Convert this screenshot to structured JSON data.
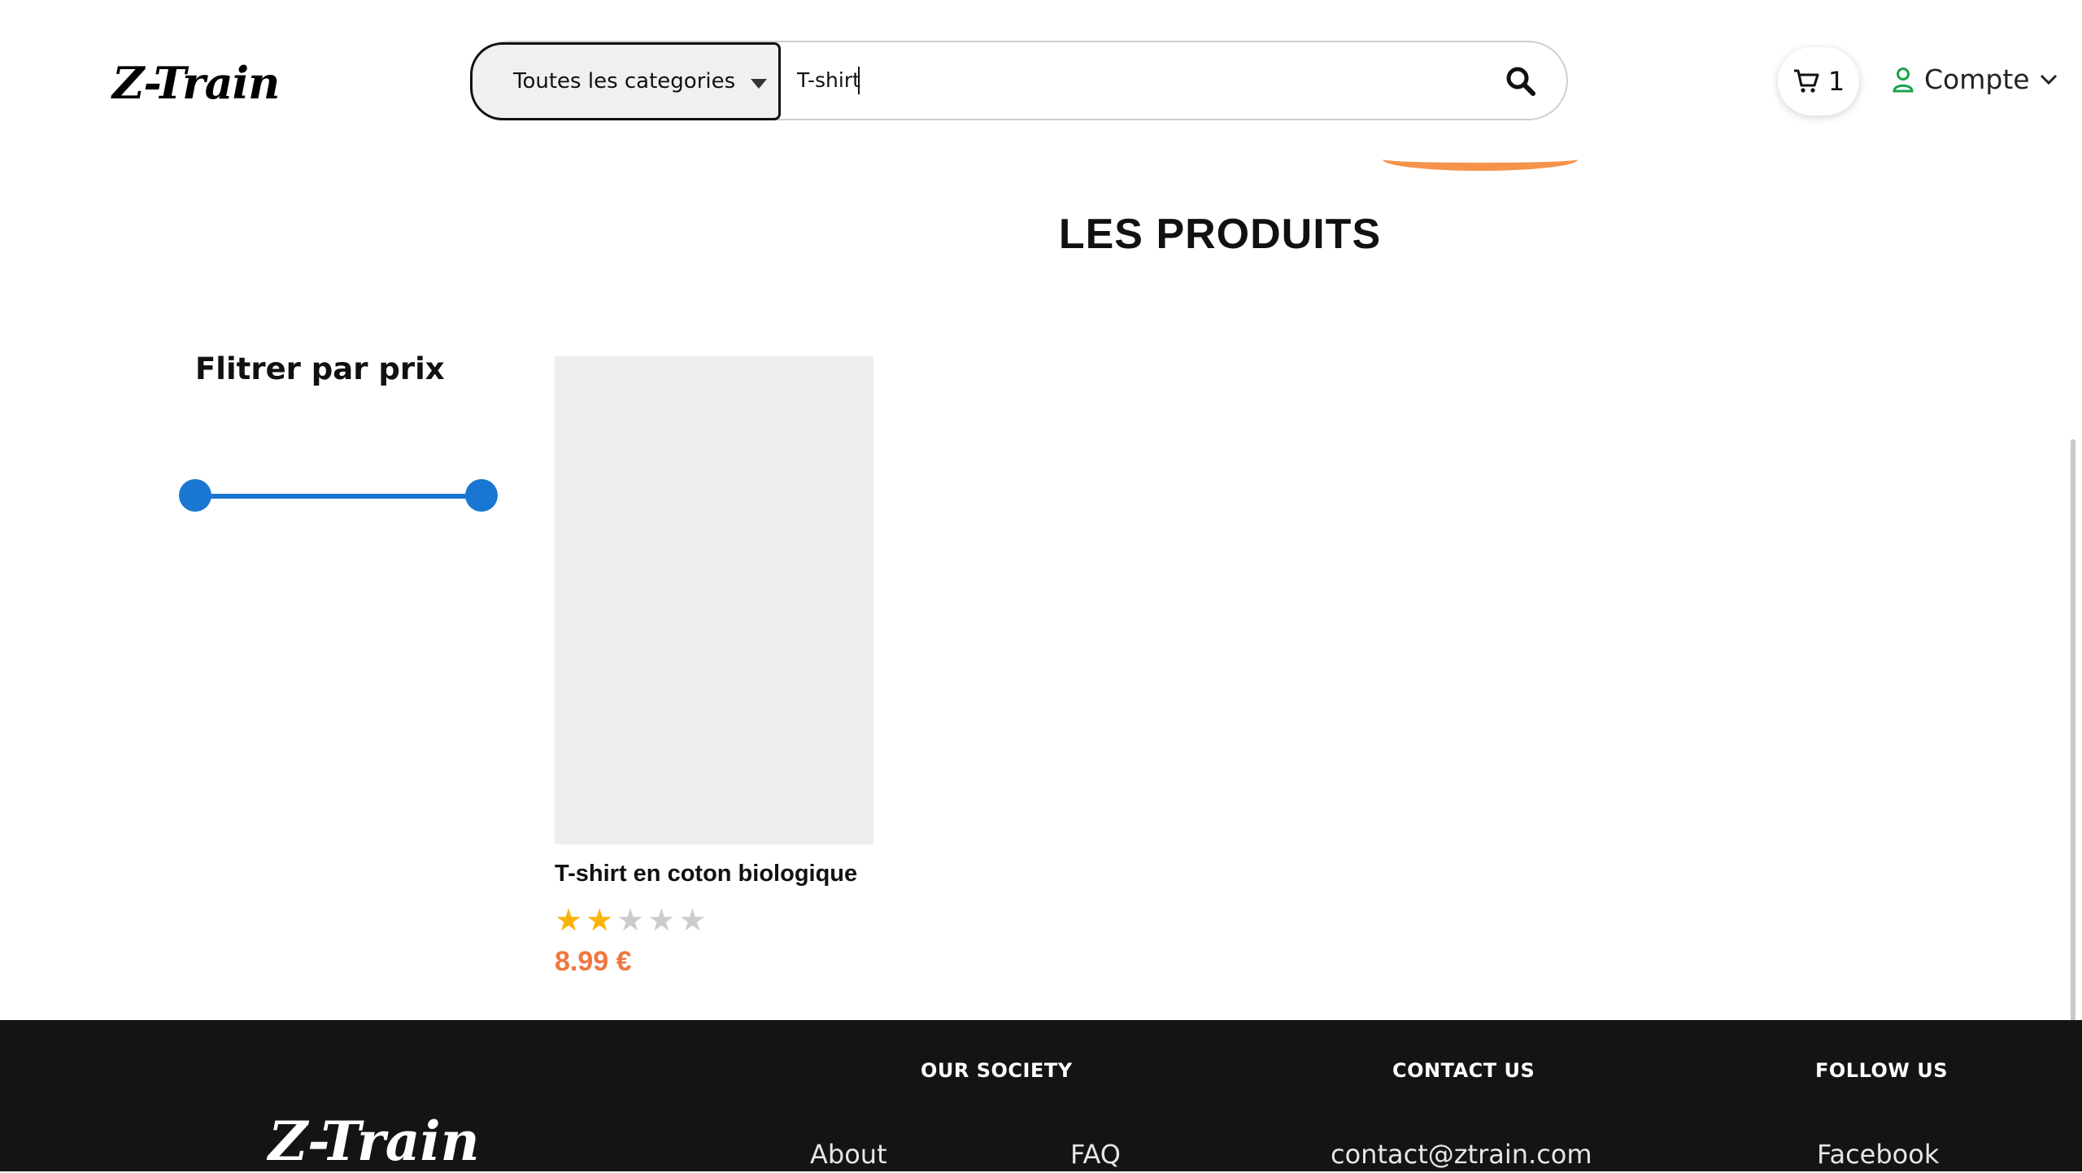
{
  "header": {
    "logo": "Z-Train",
    "category_select": "Toutes les categories",
    "search_value": "T-shirt",
    "cart_count": "1",
    "account_label": "Compte"
  },
  "main": {
    "title": "LES PRODUITS",
    "filter_title": "Flitrer par prix",
    "products": [
      {
        "name": "T-shirt en coton biologique",
        "rating": 2,
        "max_rating": 5,
        "price": "8.99 €"
      }
    ]
  },
  "footer": {
    "logo": "Z-Train",
    "columns": {
      "society": {
        "title": "OUR SOCIETY",
        "links": [
          "About",
          "FAQ"
        ]
      },
      "contact": {
        "title": "CONTACT US",
        "links": [
          "contact@ztrain.com"
        ]
      },
      "follow": {
        "title": "FOLLOW US",
        "links": [
          "Facebook"
        ]
      }
    }
  },
  "colors": {
    "accent": "#1976d2",
    "price": "#f0773f",
    "star_on": "#fbb40c",
    "star_off": "#cccccc",
    "footer_bg": "#141414"
  },
  "icons": [
    "search-icon",
    "cart-icon",
    "user-icon",
    "chevron-down-icon",
    "star-icon"
  ]
}
